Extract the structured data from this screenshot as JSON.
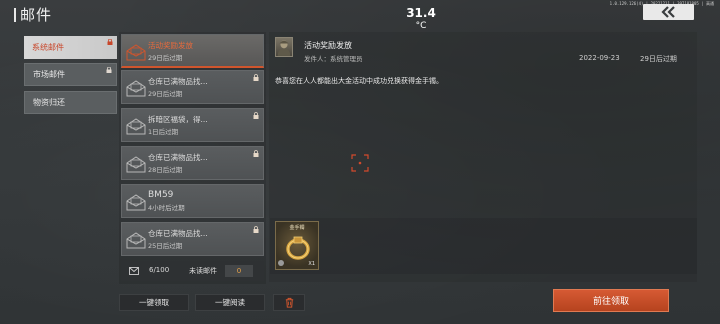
{
  "header": {
    "title": "邮件",
    "temperature_value": "31.4",
    "temperature_unit": "°C",
    "sysinfo": "1.0.129.126(4) | 20221211 | 397181805 | 高通"
  },
  "categories": [
    {
      "label": "系统邮件",
      "active": true
    },
    {
      "label": "市场邮件",
      "active": false
    },
    {
      "label": "物资归还",
      "active": false
    }
  ],
  "mails": [
    {
      "title": "活动奖励发放",
      "subtitle": "29日后过期",
      "selected": true
    },
    {
      "title": "仓库已满物品找...",
      "subtitle": "29日后过期",
      "selected": false
    },
    {
      "title": "拆暗区福袋，得...",
      "subtitle": "1日后过期",
      "selected": false
    },
    {
      "title": "仓库已满物品找...",
      "subtitle": "28日后过期",
      "selected": false
    },
    {
      "title": "BM59",
      "subtitle": "4小时后过期",
      "selected": false
    },
    {
      "title": "仓库已满物品找...",
      "subtitle": "25日后过期",
      "selected": false
    }
  ],
  "counter": {
    "count": "6/100",
    "unread_label": "未读邮件",
    "unread_count": "0"
  },
  "actions": {
    "claim_all": "一键领取",
    "read_all": "一键阅读",
    "claim": "前往领取"
  },
  "detail": {
    "title": "活动奖励发放",
    "sender_label": "发件人：系统管理员",
    "date": "2022-09-23",
    "expire": "29日后过期",
    "body": "恭喜您在人人都能出大金活动中成功兑换获得金手镯。"
  },
  "attachment": {
    "name": "金手镯",
    "quantity": "X1"
  },
  "colors": {
    "accent": "#c8462a",
    "claim_button": "#c94e28",
    "unread_count": "#e8a34a"
  }
}
